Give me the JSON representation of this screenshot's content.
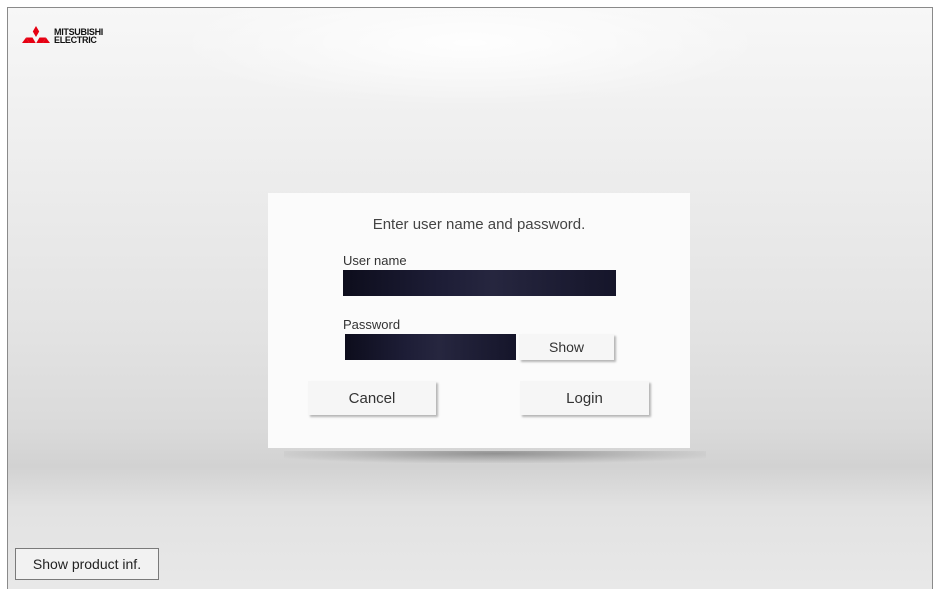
{
  "brand": {
    "logo_name": "mitsubishi-electric-logo",
    "line1": "MITSUBISHI",
    "line2": "ELECTRIC",
    "logo_color": "#e60012"
  },
  "dialog": {
    "title": "Enter user name and password.",
    "username_label": "User name",
    "username_value": "",
    "password_label": "Password",
    "password_value": "",
    "show_label": "Show",
    "cancel_label": "Cancel",
    "login_label": "Login"
  },
  "footer": {
    "product_info_label": "Show product inf."
  }
}
